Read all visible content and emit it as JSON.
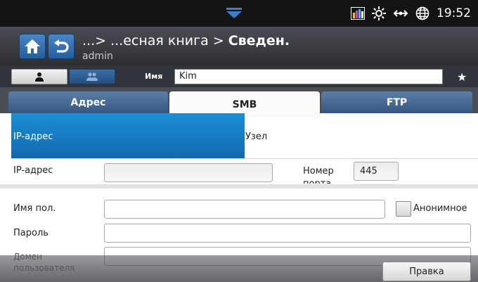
{
  "status_bar": {
    "time": "19:52",
    "icons": [
      "pulldown-arrow-icon",
      "meter-icon",
      "toner-sun-icon",
      "network-icon",
      "globe-icon"
    ]
  },
  "title_bar": {
    "breadcrumb_prefix": "...> ...есная книга >",
    "breadcrumb_current": "Сведен.",
    "user": "admin",
    "icons": [
      "home-icon",
      "back-icon"
    ]
  },
  "search_row": {
    "name_label": "Имя",
    "name_value": "Kim",
    "icons": [
      "person-icon",
      "group-icon",
      "star-icon"
    ]
  },
  "tabs": [
    {
      "label": "Адрес",
      "selected": false
    },
    {
      "label": "SMB",
      "selected": true
    },
    {
      "label": "FTP",
      "selected": false
    }
  ],
  "mode": {
    "ip_label": "IP-адрес",
    "node_label": "Узел",
    "selected": "IP-адрес"
  },
  "form": {
    "ip_label": "IP-адрес",
    "ip_value": "",
    "port_label": "Номер порта",
    "port_value": "445",
    "username_label": "Имя пол.",
    "username_value": "",
    "anonymous_label": "Анонимное",
    "anonymous_checked": false,
    "password_label": "Пароль",
    "password_value": "",
    "domain_label": "Домен пользователя",
    "domain_value": ""
  },
  "bottom_bar": {
    "edit_label": "Правка"
  },
  "colors": {
    "accent_blue": "#1a84cc",
    "status_bar": "#141414",
    "title_bar": "#3a3c41"
  }
}
